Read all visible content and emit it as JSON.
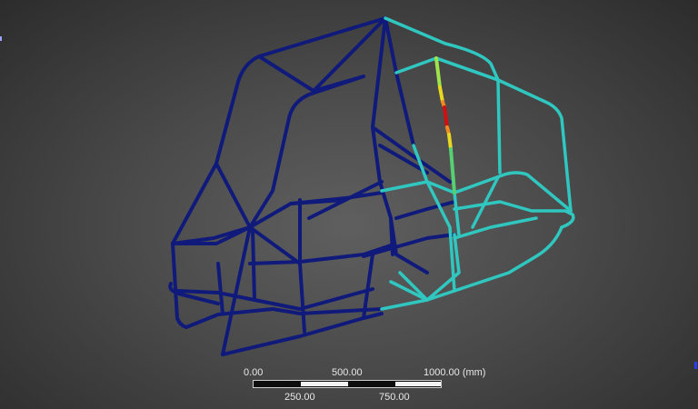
{
  "colors": {
    "background_center": "#5f5f5f",
    "background_edge": "#2c2c2c",
    "member_low_stress": "#101a7a",
    "member_mid_stress": "#2fc7c0",
    "member_high_stress": "#d01010",
    "member_elevated_stress": "#e8d820"
  },
  "scale_bar": {
    "top_labels": [
      "0.00",
      "500.00",
      "1000.00 (mm)"
    ],
    "bottom_labels": [
      "250.00",
      "750.00"
    ]
  }
}
